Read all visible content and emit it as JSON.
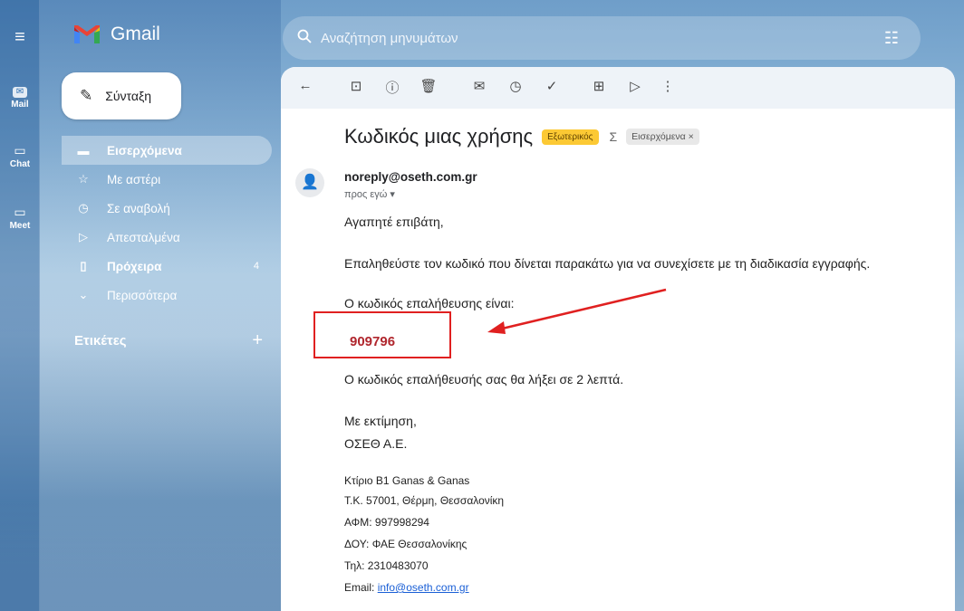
{
  "app": {
    "name": "Gmail"
  },
  "rail": {
    "items": [
      {
        "label": "Mail",
        "icon": "mail-icon"
      },
      {
        "label": "Chat",
        "icon": "chat-icon"
      },
      {
        "label": "Meet",
        "icon": "video-icon"
      }
    ]
  },
  "search": {
    "placeholder": "Αναζήτηση μηνυμάτων"
  },
  "compose": {
    "label": "Σύνταξη"
  },
  "nav": {
    "items": [
      {
        "label": "Εισερχόμενα",
        "icon": "inbox-icon",
        "active": true
      },
      {
        "label": "Με αστέρι",
        "icon": "star-icon"
      },
      {
        "label": "Σε αναβολή",
        "icon": "clock-icon"
      },
      {
        "label": "Απεσταλμένα",
        "icon": "send-icon"
      },
      {
        "label": "Πρόχειρα",
        "icon": "draft-icon",
        "count": "4"
      },
      {
        "label": "Περισσότερα",
        "icon": "chevron-down-icon"
      }
    ],
    "labels_heading": "Ετικέτες"
  },
  "email": {
    "subject": "Κωδικός μιας χρήσης",
    "tag_external": "Εξωτερικός",
    "tag_inbox": "Εισερχόμενα ×",
    "sender": "noreply@oseth.com.gr",
    "to": "προς εγώ ▾",
    "greeting": "Αγαπητέ επιβάτη,",
    "instruction": "Επαληθεύστε τον κωδικό που δίνεται παρακάτω για να συνεχίσετε με τη διαδικασία εγγραφής.",
    "code_label": "Ο κωδικός επαλήθευσης είναι:",
    "code": "909796",
    "expiry": "Ο κωδικός επαλήθευσής σας θα λήξει σε 2 λεπτά.",
    "regards": "Με εκτίμηση,",
    "company": "ΟΣΕΘ Α.Ε.",
    "footer": {
      "address1": "Κτίριο Β1 Ganas & Ganas",
      "address2": "Τ.Κ. 57001, Θέρμη, Θεσσαλονίκη",
      "afm": "ΑΦΜ: 997998294",
      "doy": "ΔΟΥ: ΦΑΕ Θεσσαλονίκης",
      "phone": "Τηλ: 2310483070",
      "email_label": "Email: ",
      "email_link": "info@oseth.com.gr"
    }
  },
  "colors": {
    "highlight_box": "#e02020",
    "code": "#b0262d",
    "tag_external": "#fcc934"
  }
}
